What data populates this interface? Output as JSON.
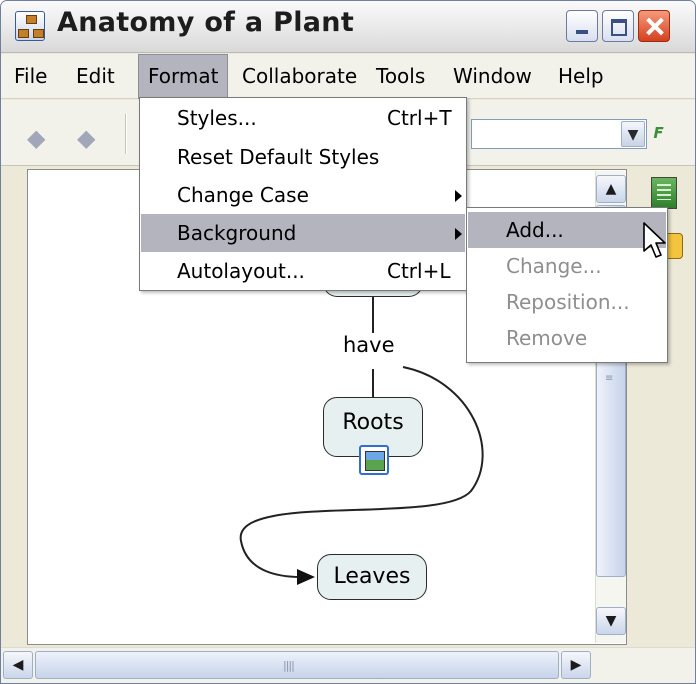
{
  "window": {
    "title": "Anatomy of a Plant"
  },
  "menubar": {
    "items": [
      "File",
      "Edit",
      "Format",
      "Collaborate",
      "Tools",
      "Window",
      "Help"
    ]
  },
  "format_menu": {
    "items": [
      {
        "label": "Styles...",
        "shortcut": "Ctrl+T"
      },
      {
        "label": "Reset Default Styles",
        "shortcut": ""
      },
      {
        "label": "Change Case",
        "shortcut": ""
      },
      {
        "label": "Background",
        "shortcut": ""
      },
      {
        "label": "Autolayout...",
        "shortcut": "Ctrl+L"
      }
    ]
  },
  "background_submenu": {
    "items": [
      {
        "label": "Add...",
        "enabled": true
      },
      {
        "label": "Change...",
        "enabled": false
      },
      {
        "label": "Reposition...",
        "enabled": false
      },
      {
        "label": "Remove",
        "enabled": false
      }
    ]
  },
  "concept_map": {
    "link_label": "have",
    "nodes": [
      "Roots",
      "Leaves"
    ]
  },
  "icons": {
    "back": "back-arrow-icon",
    "forward": "forward-arrow-icon",
    "style": "style-palette-icon",
    "document": "document-icon",
    "image": "image-icon"
  },
  "colors": {
    "menu_highlight": "#b3b4bd",
    "node_fill": "#e7f0f1",
    "disabled_text": "#8e8e8e"
  }
}
